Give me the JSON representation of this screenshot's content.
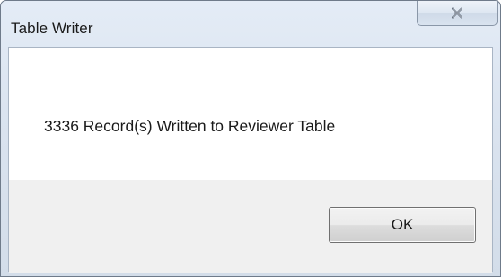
{
  "dialog": {
    "title": "Table Writer",
    "message": "3336 Record(s) Written to Reviewer Table",
    "ok_label": "OK",
    "close_icon": "close-icon"
  },
  "colors": {
    "frame_border": "#6f7b8a",
    "titlebar": "#dbe4f0",
    "content_bg": "#ffffff",
    "footer_bg": "#f0f0f0",
    "text": "#1a1a1a"
  }
}
